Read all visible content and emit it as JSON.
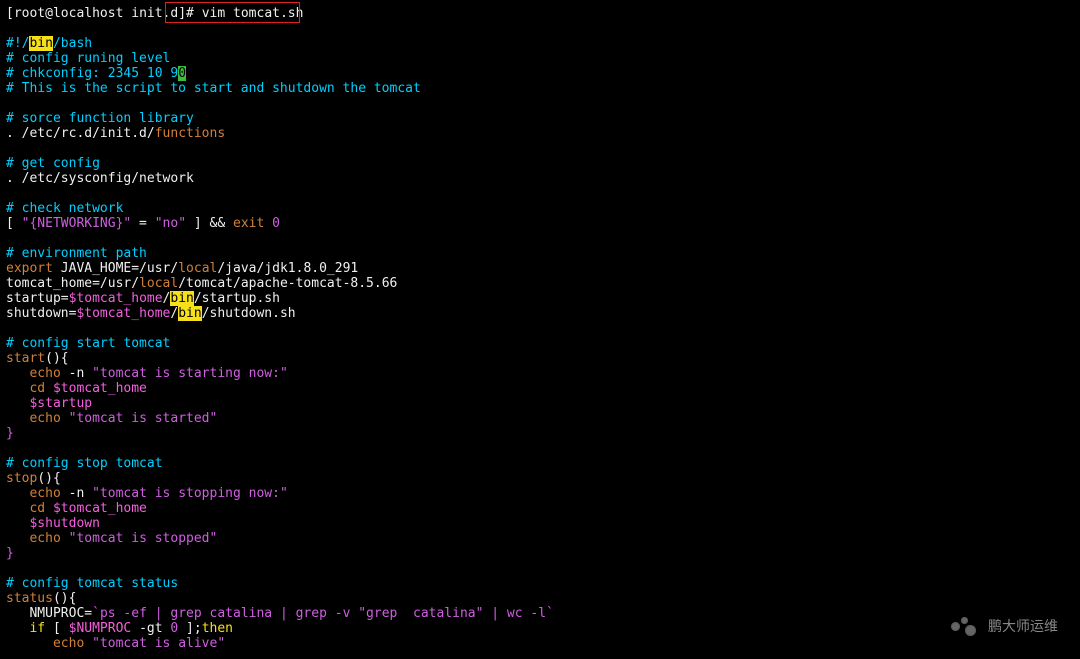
{
  "prompt": {
    "user": "root",
    "host": "localhost",
    "cwd": "init.d",
    "cmd": "vim tomcat.sh"
  },
  "watermark": "鹏大师运维",
  "script": {
    "shebang_pre": "#!/",
    "shebang_bin": "bin",
    "shebang_post": "/bash",
    "c_runlevel": "# config runing level",
    "c_chk_pre": "# chkconfig: 2345 10 9",
    "c_chk_cursor": "0",
    "c_desc": "# This is the script to start and shutdown the tomcat",
    "c_srclib": "# sorce function library",
    "src_lib_dot": ". ",
    "src_lib_path": "/etc/rc.d/init.d/",
    "src_lib_fn": "functions",
    "c_getcfg": "# get config",
    "src_net": ". /etc/sysconfig/network",
    "c_chknet": "# check network",
    "chknet_l": "[ ",
    "chknet_var": "\"{NETWORKING}\"",
    "chknet_eq": " = ",
    "chknet_no": "\"no\"",
    "chknet_r": " ] && ",
    "chknet_exit": "exit",
    "chknet_sp": " ",
    "chknet_zero": "0",
    "c_env": "# environment path",
    "env_exp": "export",
    "env_jh": " JAVA_HOME",
    "env_eq": "=",
    "env_jhp_a": "/usr/",
    "env_local": "local",
    "env_jhp_b": "/java/jdk1.8.0_291",
    "env_th": "tomcat_home=",
    "env_thp_a": "/usr/",
    "env_thp_b": "/tomcat/apache-tomcat-8.5.66",
    "env_su": "startup=",
    "env_su_var": "$tomcat_home",
    "env_su_bin": "bin",
    "env_su_p": "/startup.sh",
    "slash": "/",
    "env_sd": "shutdown=",
    "env_sd_var": "$tomcat_home",
    "env_sd_bin": "bin",
    "env_sd_p": "/shutdown.sh",
    "c_start": "# config start tomcat",
    "fn_start": "start",
    "fn_paren": "(){",
    "echo": "echo",
    "echo_n": " -n ",
    "s1": "\"tomcat is starting now:\"",
    "cd": "cd ",
    "tc_home": "$tomcat_home",
    "startup_var": "$startup",
    "s2": "\"tomcat is started\"",
    "brace_close": "}",
    "c_stop": "# config stop tomcat",
    "fn_stop": "stop",
    "s3": "\"tomcat is stopping now:\"",
    "shutdown_var": "$shutdown",
    "s4": "\"tomcat is stopped\"",
    "c_status": "# config tomcat status",
    "fn_status": "status",
    "nm_lhs": "NMUPROC=",
    "bt": "`",
    "nm_cmd": "ps -ef | grep catalina | grep -v \"grep  catalina\" | wc -l",
    "if": "if",
    "if_l": " [ ",
    "numproc": "$NUMPROC",
    "gt": " -gt ",
    "zero": "0",
    "if_r": " ];",
    "then": "then",
    "s5": "\"tomcat is alive\"",
    "indent": "   ",
    "sp": " "
  }
}
